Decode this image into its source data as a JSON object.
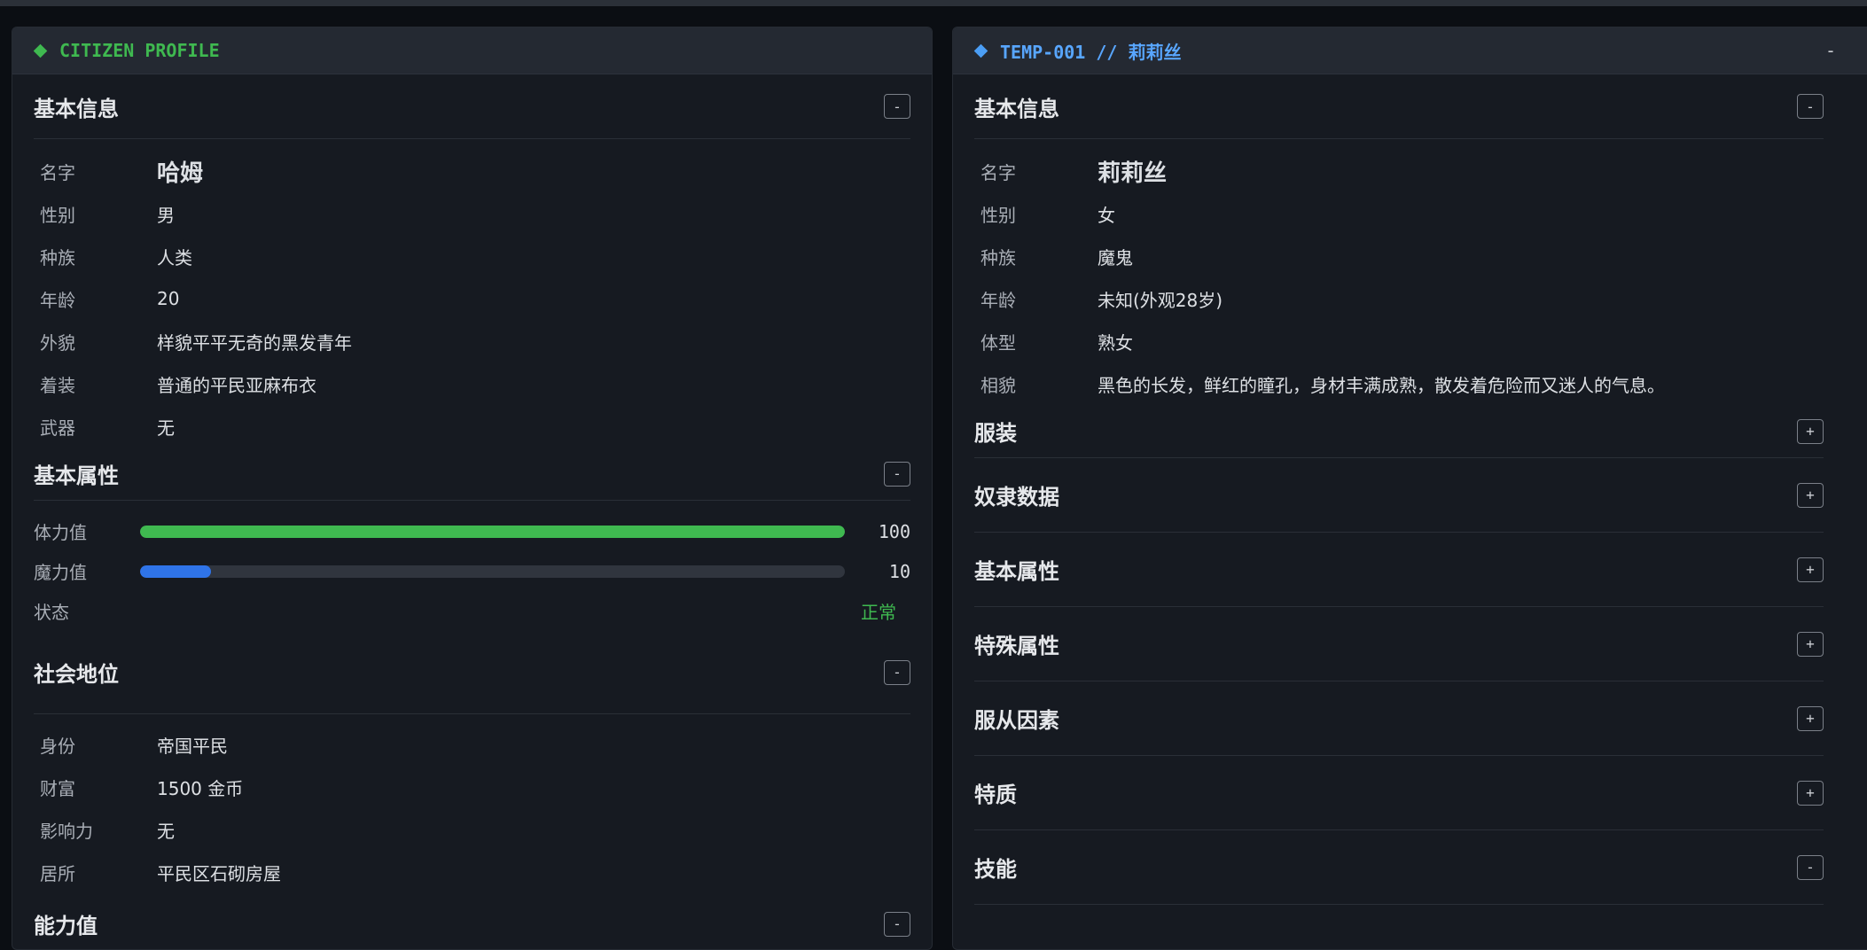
{
  "left_panel": {
    "header": "CITIZEN PROFILE",
    "basic_info": {
      "title": "基本信息",
      "toggle": "-",
      "rows": [
        {
          "label": "名字",
          "value": "哈姆"
        },
        {
          "label": "性别",
          "value": "男"
        },
        {
          "label": "种族",
          "value": "人类"
        },
        {
          "label": "年龄",
          "value": "20"
        },
        {
          "label": "外貌",
          "value": "样貌平平无奇的黑发青年"
        },
        {
          "label": "着装",
          "value": "普通的平民亚麻布衣"
        },
        {
          "label": "武器",
          "value": "无"
        }
      ]
    },
    "attributes": {
      "title": "基本属性",
      "toggle": "-",
      "stamina": {
        "label": "体力值",
        "value": "100",
        "fill_percent": 100,
        "color": "#3fb950"
      },
      "mana": {
        "label": "魔力值",
        "value": "10",
        "fill_percent": 10,
        "color": "#2f74e8"
      },
      "status": {
        "label": "状态",
        "value": "正常"
      }
    },
    "social": {
      "title": "社会地位",
      "toggle": "-",
      "rows": [
        {
          "label": "身份",
          "value": "帝国平民"
        },
        {
          "label": "财富",
          "value": "1500 金币"
        },
        {
          "label": "影响力",
          "value": "无"
        },
        {
          "label": "居所",
          "value": "平民区石砌房屋"
        }
      ]
    },
    "next_section": {
      "title": "能力值",
      "toggle": "-"
    }
  },
  "right_panel": {
    "header": "TEMP-001 // 莉莉丝",
    "header_button": "-",
    "basic_info": {
      "title": "基本信息",
      "toggle": "-",
      "rows": [
        {
          "label": "名字",
          "value": "莉莉丝"
        },
        {
          "label": "性别",
          "value": "女"
        },
        {
          "label": "种族",
          "value": "魔鬼"
        },
        {
          "label": "年龄",
          "value": "未知(外观28岁)"
        },
        {
          "label": "体型",
          "value": "熟女"
        },
        {
          "label": "相貌",
          "value": "黑色的长发，鲜红的瞳孔，身材丰满成熟，散发着危险而又迷人的气息。"
        }
      ]
    },
    "sections": [
      {
        "title": "服装",
        "toggle": "+"
      },
      {
        "title": "奴隶数据",
        "toggle": "+"
      },
      {
        "title": "基本属性",
        "toggle": "+"
      },
      {
        "title": "特殊属性",
        "toggle": "+"
      },
      {
        "title": "服从因素",
        "toggle": "+"
      },
      {
        "title": "特质",
        "toggle": "+"
      },
      {
        "title": "技能",
        "toggle": "-"
      }
    ]
  },
  "colors": {
    "accent_green": "#3fb950",
    "accent_blue": "#58a6ff",
    "panel_bg": "#161a21",
    "header_bg": "#242932"
  }
}
